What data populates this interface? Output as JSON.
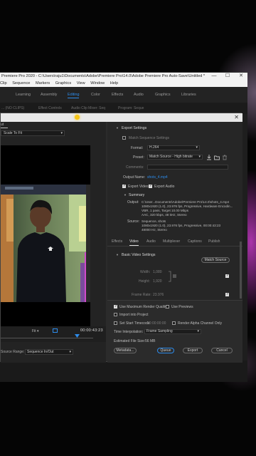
{
  "window": {
    "title": "Premiere Pro 2020 - C:\\Users\\raju1\\Documents\\Adobe\\Premiere Pro\\14.0\\Adobe Premiere Pro Auto-Save\\Untitled *",
    "minimize": "—",
    "maximize": "☐",
    "close": "✕"
  },
  "menu": [
    "Clip",
    "Sequence",
    "Markers",
    "Graphics",
    "View",
    "Window",
    "Help"
  ],
  "workspaces": [
    "Learning",
    "Assembly",
    "Editing",
    "Color",
    "Effects",
    "Audio",
    "Graphics",
    "Libraries"
  ],
  "workspaces_active": "Editing",
  "panel_tabs": [
    "...  (NO CLIPS)",
    "Effect Controls",
    "Audio Clip Mixer: Seq",
    "Program: Seque"
  ],
  "dialog": {
    "close": "✕",
    "source_tab": "ut",
    "scale": "Scale To Fit",
    "fit": "Fit",
    "timecode": "00:00:43:23",
    "source_range_label": "Source Range:",
    "source_range": "Sequence In/Out"
  },
  "export": {
    "section": "Export Settings",
    "match_sequence": "Match Sequence Settings",
    "format_label": "Format:",
    "format": "H.264",
    "preset_label": "Preset:",
    "preset": "Match Source - High bitrate",
    "comments_label": "Comments:",
    "output_name_label": "Output Name:",
    "output_name": "shots_4.mp4",
    "export_video": "Export Video",
    "export_audio": "Export Audio",
    "summary": "Summary",
    "output_label": "Output:",
    "output_lines": [
      "C:\\User...Documents\\Adobe\\Premiere Pro\\14.0\\shots_4.mp4",
      "1080x1920 (1.0), 23.976 fps, Progressive, Hardware Encodin...",
      "VBR, 1 pass, Target 10.00 Mbps",
      "AAC, 320 kbps, 48 kHz, Stereo"
    ],
    "source_label": "Source:",
    "source_lines": [
      "Sequence, shots",
      "1080x1920 (1.0), 23.976 fps, Progressive, 00:00:43:23",
      "48000 Hz, Stereo"
    ],
    "tabs": [
      "Effects",
      "Video",
      "Audio",
      "Multiplexer",
      "Captions",
      "Publish"
    ],
    "tabs_active": "Video",
    "basic_video": "Basic Video Settings",
    "match_source_btn": "Match Source",
    "width_label": "Width:",
    "width": "1,080",
    "height_label": "Height:",
    "height": "1,920",
    "frame_rate_label": "Frame Rate:",
    "frame_rate": "23.976",
    "use_max_render": "Use Maximum Render Quality",
    "use_previews": "Use Previews",
    "import_project": "Import into Project",
    "set_start_tc": "Set Start Timecode",
    "start_tc": "00:00:00:00",
    "render_alpha": "Render Alpha Channel Only",
    "time_interp_label": "Time Interpolation:",
    "time_interp": "Frame Sampling",
    "est_size_label": "Estimated File Size:",
    "est_size": "56 MB",
    "btn_metadata": "Metadata...",
    "btn_queue": "Queue",
    "btn_export": "Export",
    "btn_cancel": "Cancel"
  },
  "colors": {
    "accent": "#2d8ceb",
    "cursor": "#f5c518",
    "glow": "#c83cc8"
  }
}
